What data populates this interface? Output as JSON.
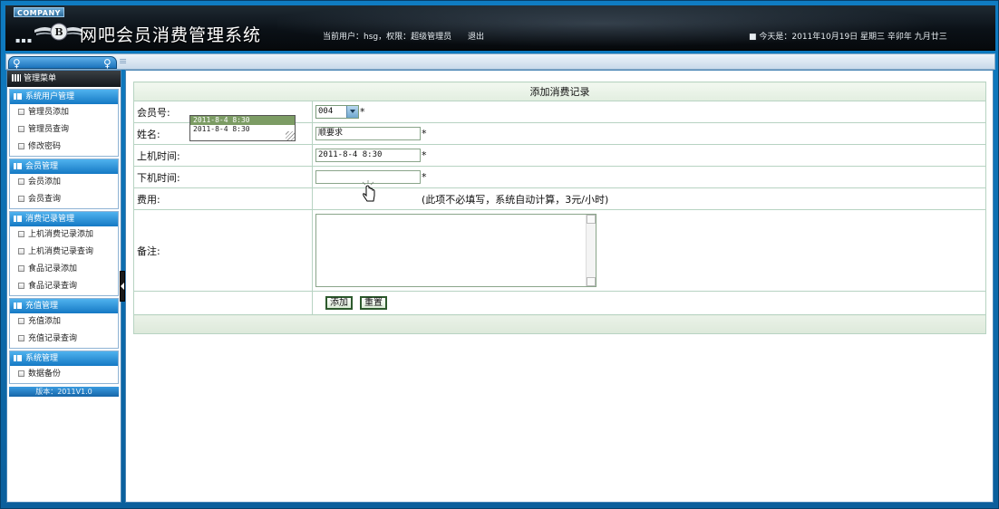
{
  "header": {
    "company": "COMPANY",
    "app_title": "网吧会员消费管理系统",
    "user_info": "当前用户：hsg，权限：超级管理员",
    "logout": "退出",
    "date_info": "■ 今天是：2011年10月19日 星期三 辛卯年 九月廿三"
  },
  "sidebar": {
    "title": "管理菜单",
    "groups": [
      {
        "title": "系统用户管理",
        "items": [
          "管理员添加",
          "管理员查询",
          "修改密码"
        ]
      },
      {
        "title": "会员管理",
        "items": [
          "会员添加",
          "会员查询"
        ]
      },
      {
        "title": "消费记录管理",
        "items": [
          "上机消费记录添加",
          "上机消费记录查询",
          "食品记录添加",
          "食品记录查询"
        ]
      },
      {
        "title": "充值管理",
        "items": [
          "充值添加",
          "充值记录查询"
        ]
      },
      {
        "title": "系统管理",
        "items": [
          "数据备份"
        ]
      }
    ],
    "version": "版本：2011V1.0"
  },
  "form": {
    "title": "添加消费记录",
    "member_no_label": "会员号:",
    "member_no_value": "004",
    "name_label": "姓名:",
    "name_value": "顺要求",
    "start_label": "上机时间:",
    "start_value": "2011-8-4 8:30",
    "end_label": "下机时间:",
    "end_value": "",
    "fee_label": "费用:",
    "fee_hint": "(此项不必填写，系统自动计算，3元/小时)",
    "remark_label": "备注:",
    "remark_value": "",
    "required_mark": "*",
    "add_button": "添加",
    "reset_button": "重置",
    "autocomplete": [
      "2011-8-4 8:30",
      "2011-8-4 8:30"
    ]
  }
}
